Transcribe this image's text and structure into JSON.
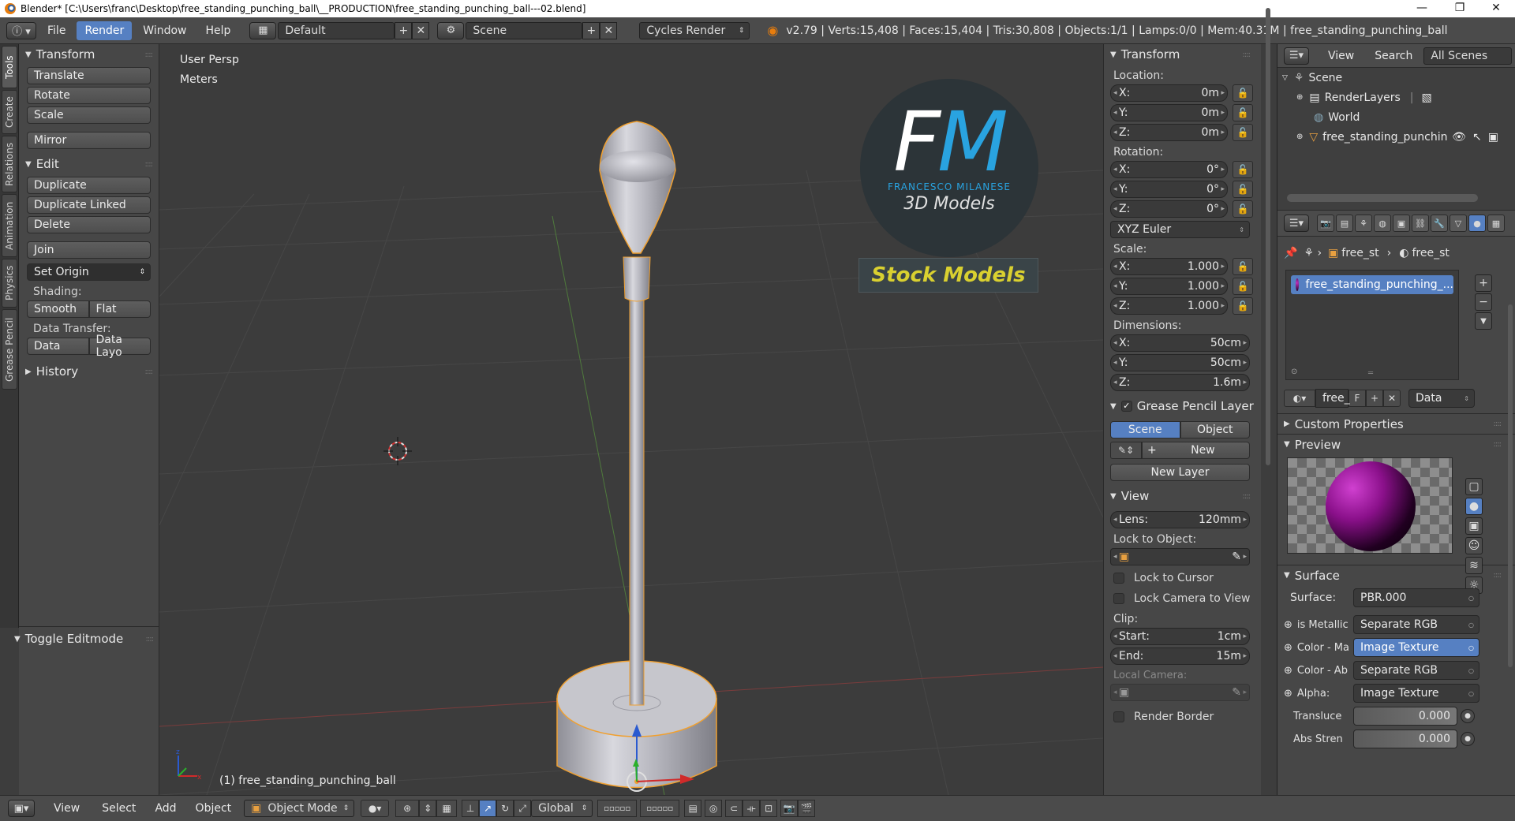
{
  "title_bar": {
    "text": "Blender* [C:\\Users\\franc\\Desktop\\free_standing_punching_ball\\__PRODUCTION\\free_standing_punching_ball---02.blend]",
    "minimize": "—",
    "maximize": "❐",
    "close": "✕"
  },
  "topbar": {
    "menus": [
      "File",
      "Render",
      "Window",
      "Help"
    ],
    "active_menu": "Render",
    "screen_layout": "Default",
    "scene": "Scene",
    "engine": "Cycles Render",
    "stats": "v2.79 | Verts:15,408 | Faces:15,404 | Tris:30,808 | Objects:1/1 | Lamps:0/0 | Mem:40.31M | free_standing_punching_ball"
  },
  "tabstrip": [
    "Tools",
    "Create",
    "Relations",
    "Animation",
    "Physics",
    "Grease Pencil"
  ],
  "toolshelf": {
    "transform_title": "Transform",
    "transform_buttons": [
      "Translate",
      "Rotate",
      "Scale"
    ],
    "mirror": "Mirror",
    "edit_title": "Edit",
    "edit_buttons": [
      "Duplicate",
      "Duplicate Linked",
      "Delete"
    ],
    "join": "Join",
    "set_origin": "Set Origin",
    "shading_label": "Shading:",
    "smooth": "Smooth",
    "flat": "Flat",
    "data_transfer_label": "Data Transfer:",
    "data": "Data",
    "data_layout": "Data Layo",
    "history": "History",
    "toggle_editmode": "Toggle Editmode"
  },
  "viewport": {
    "view_name": "User Persp",
    "units": "Meters",
    "object_label": "(1) free_standing_punching_ball",
    "logo": {
      "letters": "FM",
      "name": "FRANCESCO MILANESE",
      "tag": "3D Models",
      "stock": "Stock Models"
    }
  },
  "npanel": {
    "transform_title": "Transform",
    "location_label": "Location:",
    "location": [
      {
        "axis": "X:",
        "val": "0m"
      },
      {
        "axis": "Y:",
        "val": "0m"
      },
      {
        "axis": "Z:",
        "val": "0m"
      }
    ],
    "rotation_label": "Rotation:",
    "rotation": [
      {
        "axis": "X:",
        "val": "0°"
      },
      {
        "axis": "Y:",
        "val": "0°"
      },
      {
        "axis": "Z:",
        "val": "0°"
      }
    ],
    "rotation_mode": "XYZ Euler",
    "scale_label": "Scale:",
    "scale": [
      {
        "axis": "X:",
        "val": "1.000"
      },
      {
        "axis": "Y:",
        "val": "1.000"
      },
      {
        "axis": "Z:",
        "val": "1.000"
      }
    ],
    "dimensions_label": "Dimensions:",
    "dimensions": [
      {
        "axis": "X:",
        "val": "50cm"
      },
      {
        "axis": "Y:",
        "val": "50cm"
      },
      {
        "axis": "Z:",
        "val": "1.6m"
      }
    ],
    "grease_title": "Grease Pencil Layer",
    "gp_scene": "Scene",
    "gp_object": "Object",
    "gp_new": "New",
    "gp_new_layer": "New Layer",
    "view_title": "View",
    "lens_label": "Lens:",
    "lens": "120mm",
    "lock_obj_label": "Lock to Object:",
    "lock_cursor": "Lock to Cursor",
    "lock_camera": "Lock Camera to View",
    "clip_label": "Clip:",
    "clip_start_label": "Start:",
    "clip_start": "1cm",
    "clip_end_label": "End:",
    "clip_end": "15m",
    "local_camera": "Local Camera:",
    "render_border": "Render Border"
  },
  "outliner": {
    "view": "View",
    "search": "Search",
    "filter": "All Scenes",
    "items": [
      {
        "name": "Scene"
      },
      {
        "name": "RenderLayers"
      },
      {
        "name": "World"
      },
      {
        "name": "free_standing_punchin"
      }
    ]
  },
  "properties": {
    "breadcrumb_a": "free_st",
    "breadcrumb_b": "free_st",
    "material_slot": "free_standing_punching_...",
    "mat_name": "free_",
    "mat_f": "F",
    "mat_link": "Data",
    "custom_props": "Custom Properties",
    "preview": "Preview",
    "surface_title": "Surface",
    "surface_label": "Surface:",
    "surface_val": "PBR.000",
    "inputs": [
      {
        "label": "is Metallic",
        "val": "Separate RGB",
        "hi": false
      },
      {
        "label": "Color - Ma",
        "val": "Image Texture",
        "hi": true
      },
      {
        "label": "Color - Ab",
        "val": "Separate RGB",
        "hi": false
      },
      {
        "label": "Alpha:",
        "val": "Image Texture",
        "hi": false
      }
    ],
    "translucence_label": "Transluce",
    "translucence": "0.000",
    "abs_label": "Abs Stren",
    "abs": "0.000"
  },
  "bottombar": {
    "view": "View",
    "select": "Select",
    "add": "Add",
    "object": "Object",
    "mode": "Object Mode",
    "orientation": "Global"
  },
  "colors": {
    "accent": "#5680c2",
    "selection_outline": "#f0a030",
    "logo_blue": "#29a3e0",
    "stock_yellow": "#d9d030"
  }
}
